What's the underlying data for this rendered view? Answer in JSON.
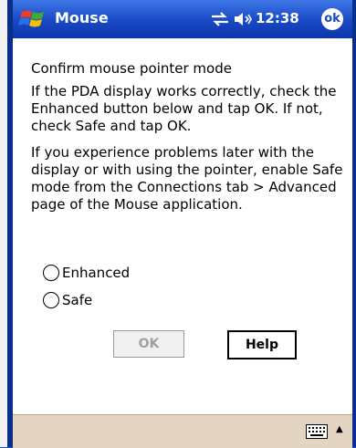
{
  "titlebar": {
    "title": "Mouse",
    "clock": "12:38",
    "ok_label": "ok"
  },
  "content": {
    "heading": "Confirm mouse pointer mode",
    "paragraph1": "If the PDA display works correctly, check the Enhanced button below and tap OK. If not, check Safe and tap OK.",
    "paragraph2": "If you experience problems later with the display or with using the pointer, enable Safe mode from the Connections tab > Advanced page of the Mouse application.",
    "radios": [
      {
        "label": "Enhanced",
        "checked": false
      },
      {
        "label": "Safe",
        "checked": false
      }
    ],
    "ok_button": "OK",
    "help_button": "Help"
  },
  "menubar": {
    "input_icon": "keyboard-icon",
    "arrow": "▲"
  },
  "colors": {
    "titlebar": "#1848c4",
    "menubar": "#e4d4c2",
    "frame": "#0a2f8a"
  }
}
